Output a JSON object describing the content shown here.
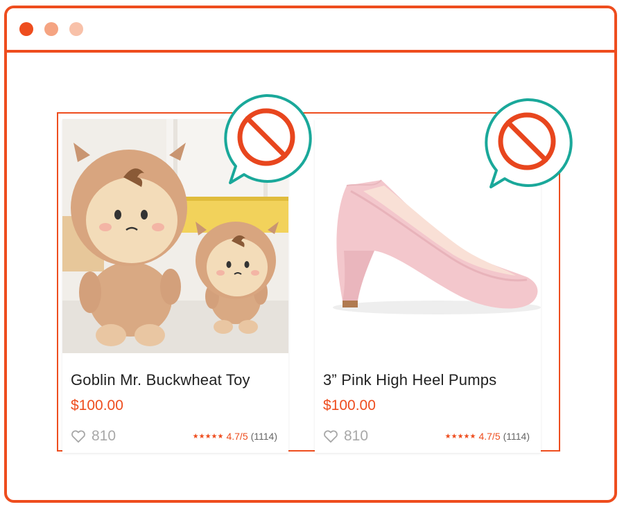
{
  "window": {
    "controls": [
      "close",
      "minimize",
      "maximize"
    ]
  },
  "products": [
    {
      "title": "Goblin Mr. Buckwheat Toy",
      "price": "$100.00",
      "likes": "810",
      "stars": "★★★★★",
      "rating": "4.7/5",
      "reviews": "(1114)"
    },
    {
      "title": "3” Pink High Heel Pumps",
      "price": "$100.00",
      "likes": "810",
      "stars": "★★★★★",
      "rating": "4.7/5",
      "reviews": "(1114)"
    }
  ],
  "colors": {
    "accent": "#ee4d1e",
    "bubble_border": "#1aa89a",
    "prohibited": "#e8461e"
  },
  "icons": [
    "heart-icon",
    "prohibited-icon",
    "star-icon"
  ]
}
